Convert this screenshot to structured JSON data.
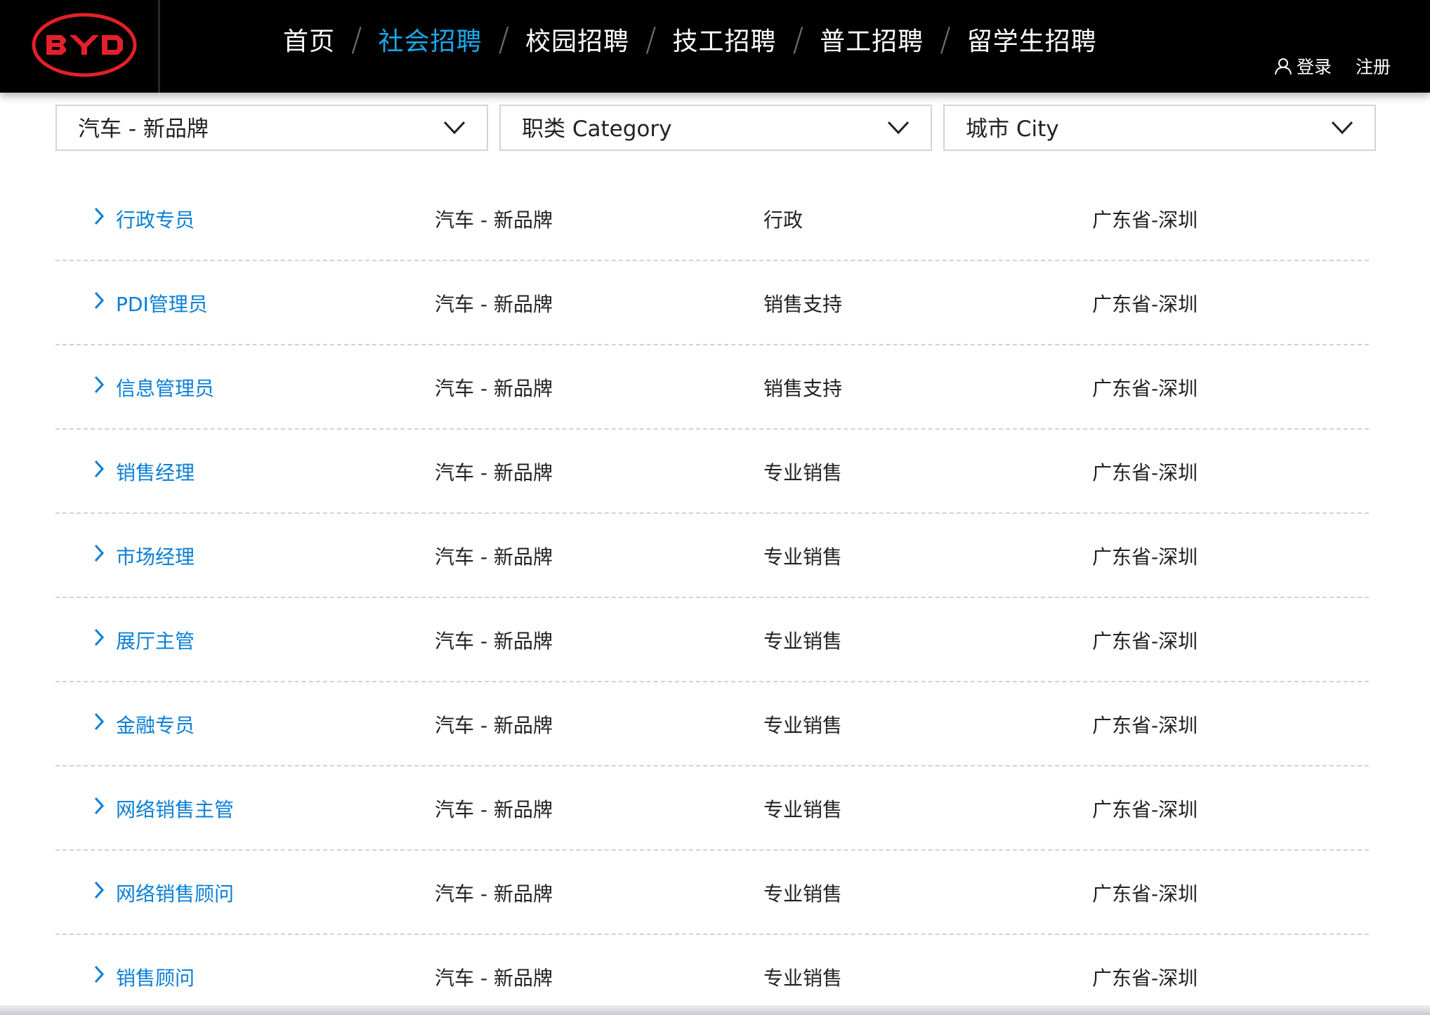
{
  "header": {
    "logo_text": "BYD",
    "nav": [
      {
        "label": "首页",
        "active": false
      },
      {
        "label": "社会招聘",
        "active": true
      },
      {
        "label": "校园招聘",
        "active": false
      },
      {
        "label": "技工招聘",
        "active": false
      },
      {
        "label": "普工招聘",
        "active": false
      },
      {
        "label": "留学生招聘",
        "active": false
      }
    ],
    "nav_separator": "/",
    "login_label": "登录",
    "register_label": "注册",
    "active_color": "#1aa7e8",
    "logo_color": "#e3202a"
  },
  "filters": {
    "business": "汽车 - 新品牌",
    "category": "职类 Category",
    "city": "城市 City"
  },
  "jobs": [
    {
      "title": "行政专员",
      "brand": "汽车 - 新品牌",
      "category": "行政",
      "city": "广东省-深圳"
    },
    {
      "title": "PDI管理员",
      "brand": "汽车 - 新品牌",
      "category": "销售支持",
      "city": "广东省-深圳"
    },
    {
      "title": "信息管理员",
      "brand": "汽车 - 新品牌",
      "category": "销售支持",
      "city": "广东省-深圳"
    },
    {
      "title": "销售经理",
      "brand": "汽车 - 新品牌",
      "category": "专业销售",
      "city": "广东省-深圳"
    },
    {
      "title": "市场经理",
      "brand": "汽车 - 新品牌",
      "category": "专业销售",
      "city": "广东省-深圳"
    },
    {
      "title": "展厅主管",
      "brand": "汽车 - 新品牌",
      "category": "专业销售",
      "city": "广东省-深圳"
    },
    {
      "title": "金融专员",
      "brand": "汽车 - 新品牌",
      "category": "专业销售",
      "city": "广东省-深圳"
    },
    {
      "title": "网络销售主管",
      "brand": "汽车 - 新品牌",
      "category": "专业销售",
      "city": "广东省-深圳"
    },
    {
      "title": "网络销售顾问",
      "brand": "汽车 - 新品牌",
      "category": "专业销售",
      "city": "广东省-深圳"
    },
    {
      "title": "销售顾问",
      "brand": "汽车 - 新品牌",
      "category": "专业销售",
      "city": "广东省-深圳"
    }
  ],
  "colors": {
    "link": "#0a7fd6",
    "header_bg": "#000000"
  }
}
